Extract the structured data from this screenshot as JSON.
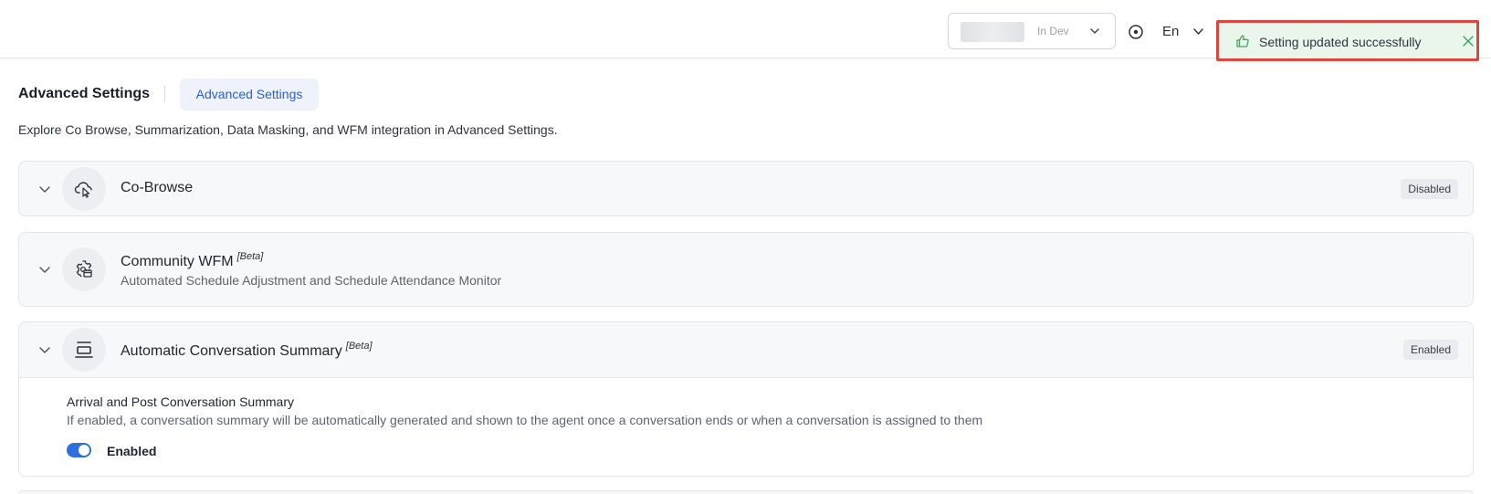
{
  "topbar": {
    "environment_label": "In Dev",
    "language": "En"
  },
  "toast": {
    "message": "Setting updated successfully"
  },
  "header": {
    "title": "Advanced Settings",
    "tab_label": "Advanced Settings",
    "description": "Explore Co Browse, Summarization, Data Masking, and WFM integration in Advanced Settings."
  },
  "sections": [
    {
      "title": "Co-Browse",
      "status": "Disabled",
      "icon": "cloud-pointer-icon"
    },
    {
      "title": "Community WFM",
      "beta": "[Beta]",
      "subtitle": "Automated Schedule Adjustment and Schedule Attendance Monitor",
      "icon": "gear-calendar-icon"
    },
    {
      "title": "Automatic Conversation Summary",
      "beta": "[Beta]",
      "status": "Enabled",
      "icon": "summary-icon",
      "setting": {
        "title": "Arrival and Post Conversation Summary",
        "description": "If enabled, a conversation summary will be automatically generated and shown to the agent once a conversation ends or when a conversation is assigned to them",
        "toggle_label": "Enabled",
        "toggle_on": true
      }
    }
  ],
  "colors": {
    "accent": "#2d6fe0",
    "toast_bg": "#eaf6ec",
    "toast_border": "#e0453d",
    "success": "#3aa757"
  }
}
